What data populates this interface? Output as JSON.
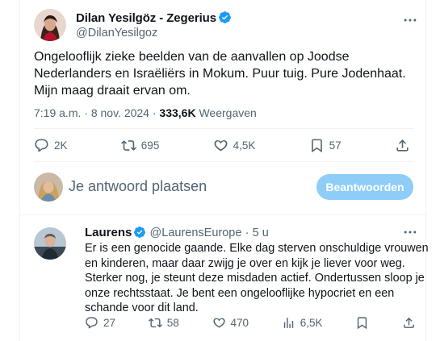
{
  "main_tweet": {
    "author_name": "Dilan Yesilgöz - Zegerius",
    "handle": "@DilanYesilgoz",
    "text": "Ongelooflijk zieke beelden van de aanvallen op Joodse Nederlanders en Israëliërs in Mokum. Puur tuig. Pure Jodenhaat. Mijn maag draait ervan om.",
    "time": "7:19 a.m.",
    "separator": "·",
    "date": "8 nov. 2024",
    "views_count": "333,6K",
    "views_label": "Weergaven",
    "actions": {
      "replies": "2K",
      "reposts": "695",
      "likes": "4,5K",
      "bookmarks": "57"
    }
  },
  "reply_composer": {
    "placeholder": "Je antwoord plaatsen",
    "button_label": "Beantwoorden"
  },
  "reply_tweet": {
    "author_name": "Laurens",
    "handle": "@LaurensEurope",
    "separator": "·",
    "age": "5 u",
    "text": "Er is een genocide gaande. Elke dag sterven onschuldige vrouwen en kinderen, maar daar zwijg je over en kijk je liever voor weg. Sterker nog, je steunt deze misdaden actief. Ondertussen sloop je onze rechtsstaat. Je bent een ongelooflijke hypocriet en een schande voor dit land.",
    "actions": {
      "replies": "27",
      "reposts": "58",
      "likes": "470",
      "views": "6,5K"
    }
  },
  "colors": {
    "verified": "#1d9bf0",
    "secondary_text": "#536471",
    "button_disabled": "#8ecdf8",
    "divider": "#eff3f4"
  },
  "icons": [
    "verified-badge-icon",
    "more-icon",
    "reply-icon",
    "repost-icon",
    "like-icon",
    "bookmark-icon",
    "share-icon",
    "views-icon"
  ]
}
